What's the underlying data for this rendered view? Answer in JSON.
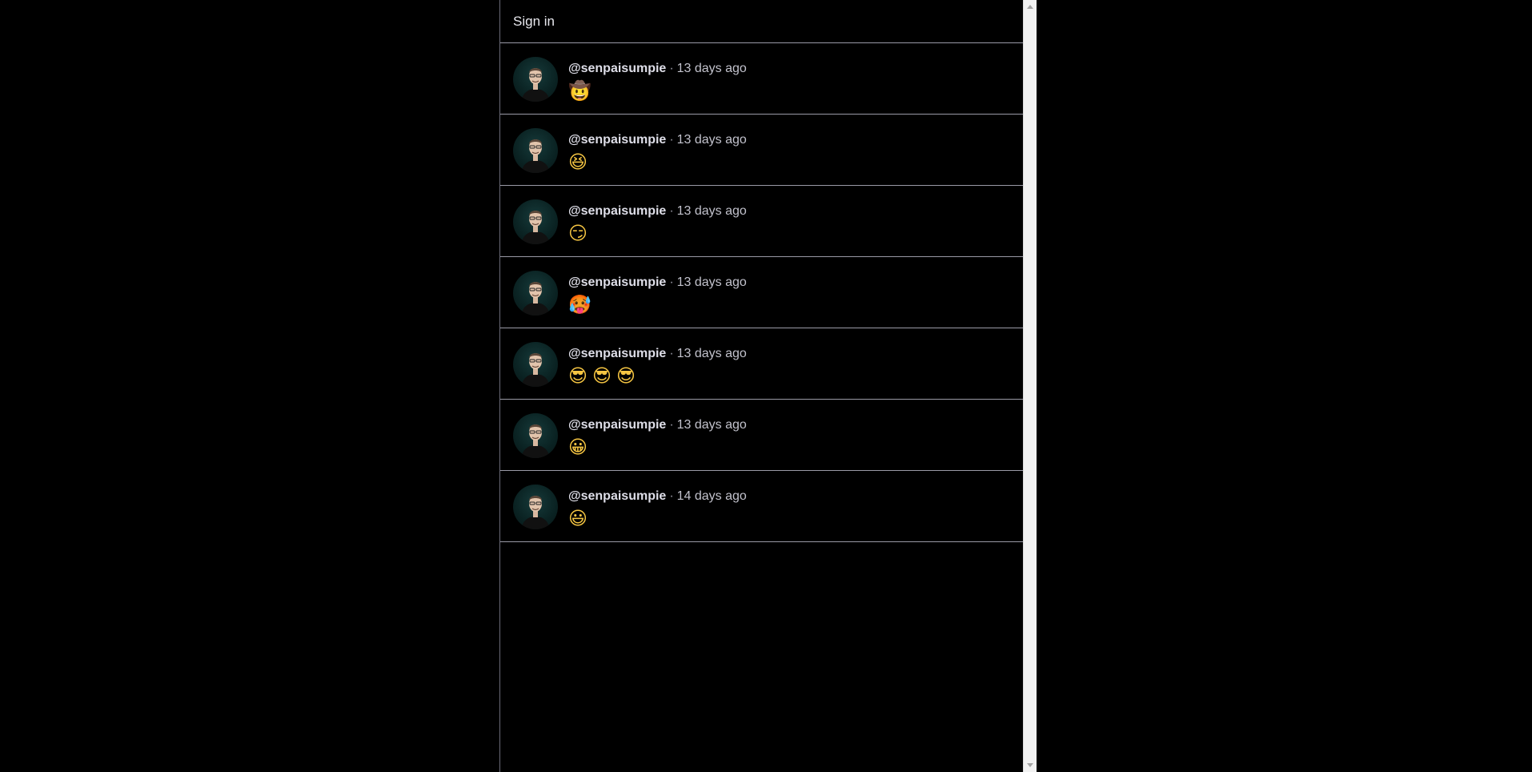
{
  "header": {
    "sign_in_label": "Sign in"
  },
  "posts": [
    {
      "author": "@senpaisumpie",
      "separator": "·",
      "time": "13 days ago",
      "content": "🤠"
    },
    {
      "author": "@senpaisumpie",
      "separator": "·",
      "time": "13 days ago",
      "content": "😆"
    },
    {
      "author": "@senpaisumpie",
      "separator": "·",
      "time": "13 days ago",
      "content": "😏"
    },
    {
      "author": "@senpaisumpie",
      "separator": "·",
      "time": "13 days ago",
      "content": "🥵"
    },
    {
      "author": "@senpaisumpie",
      "separator": "·",
      "time": "13 days ago",
      "content": "😎😎😎"
    },
    {
      "author": "@senpaisumpie",
      "separator": "·",
      "time": "13 days ago",
      "content": "😀"
    },
    {
      "author": "@senpaisumpie",
      "separator": "·",
      "time": "14 days ago",
      "content": "😃"
    }
  ],
  "icons": {
    "avatar": "user-avatar-photo",
    "scroll_up": "chevron-up-icon",
    "scroll_down": "chevron-down-icon"
  },
  "colors": {
    "background": "#000000",
    "divider": "#9a9aa6",
    "text": "#e8e8ee",
    "muted_text": "#c2c2cc",
    "scrollbar_track": "#f1f1f1"
  }
}
